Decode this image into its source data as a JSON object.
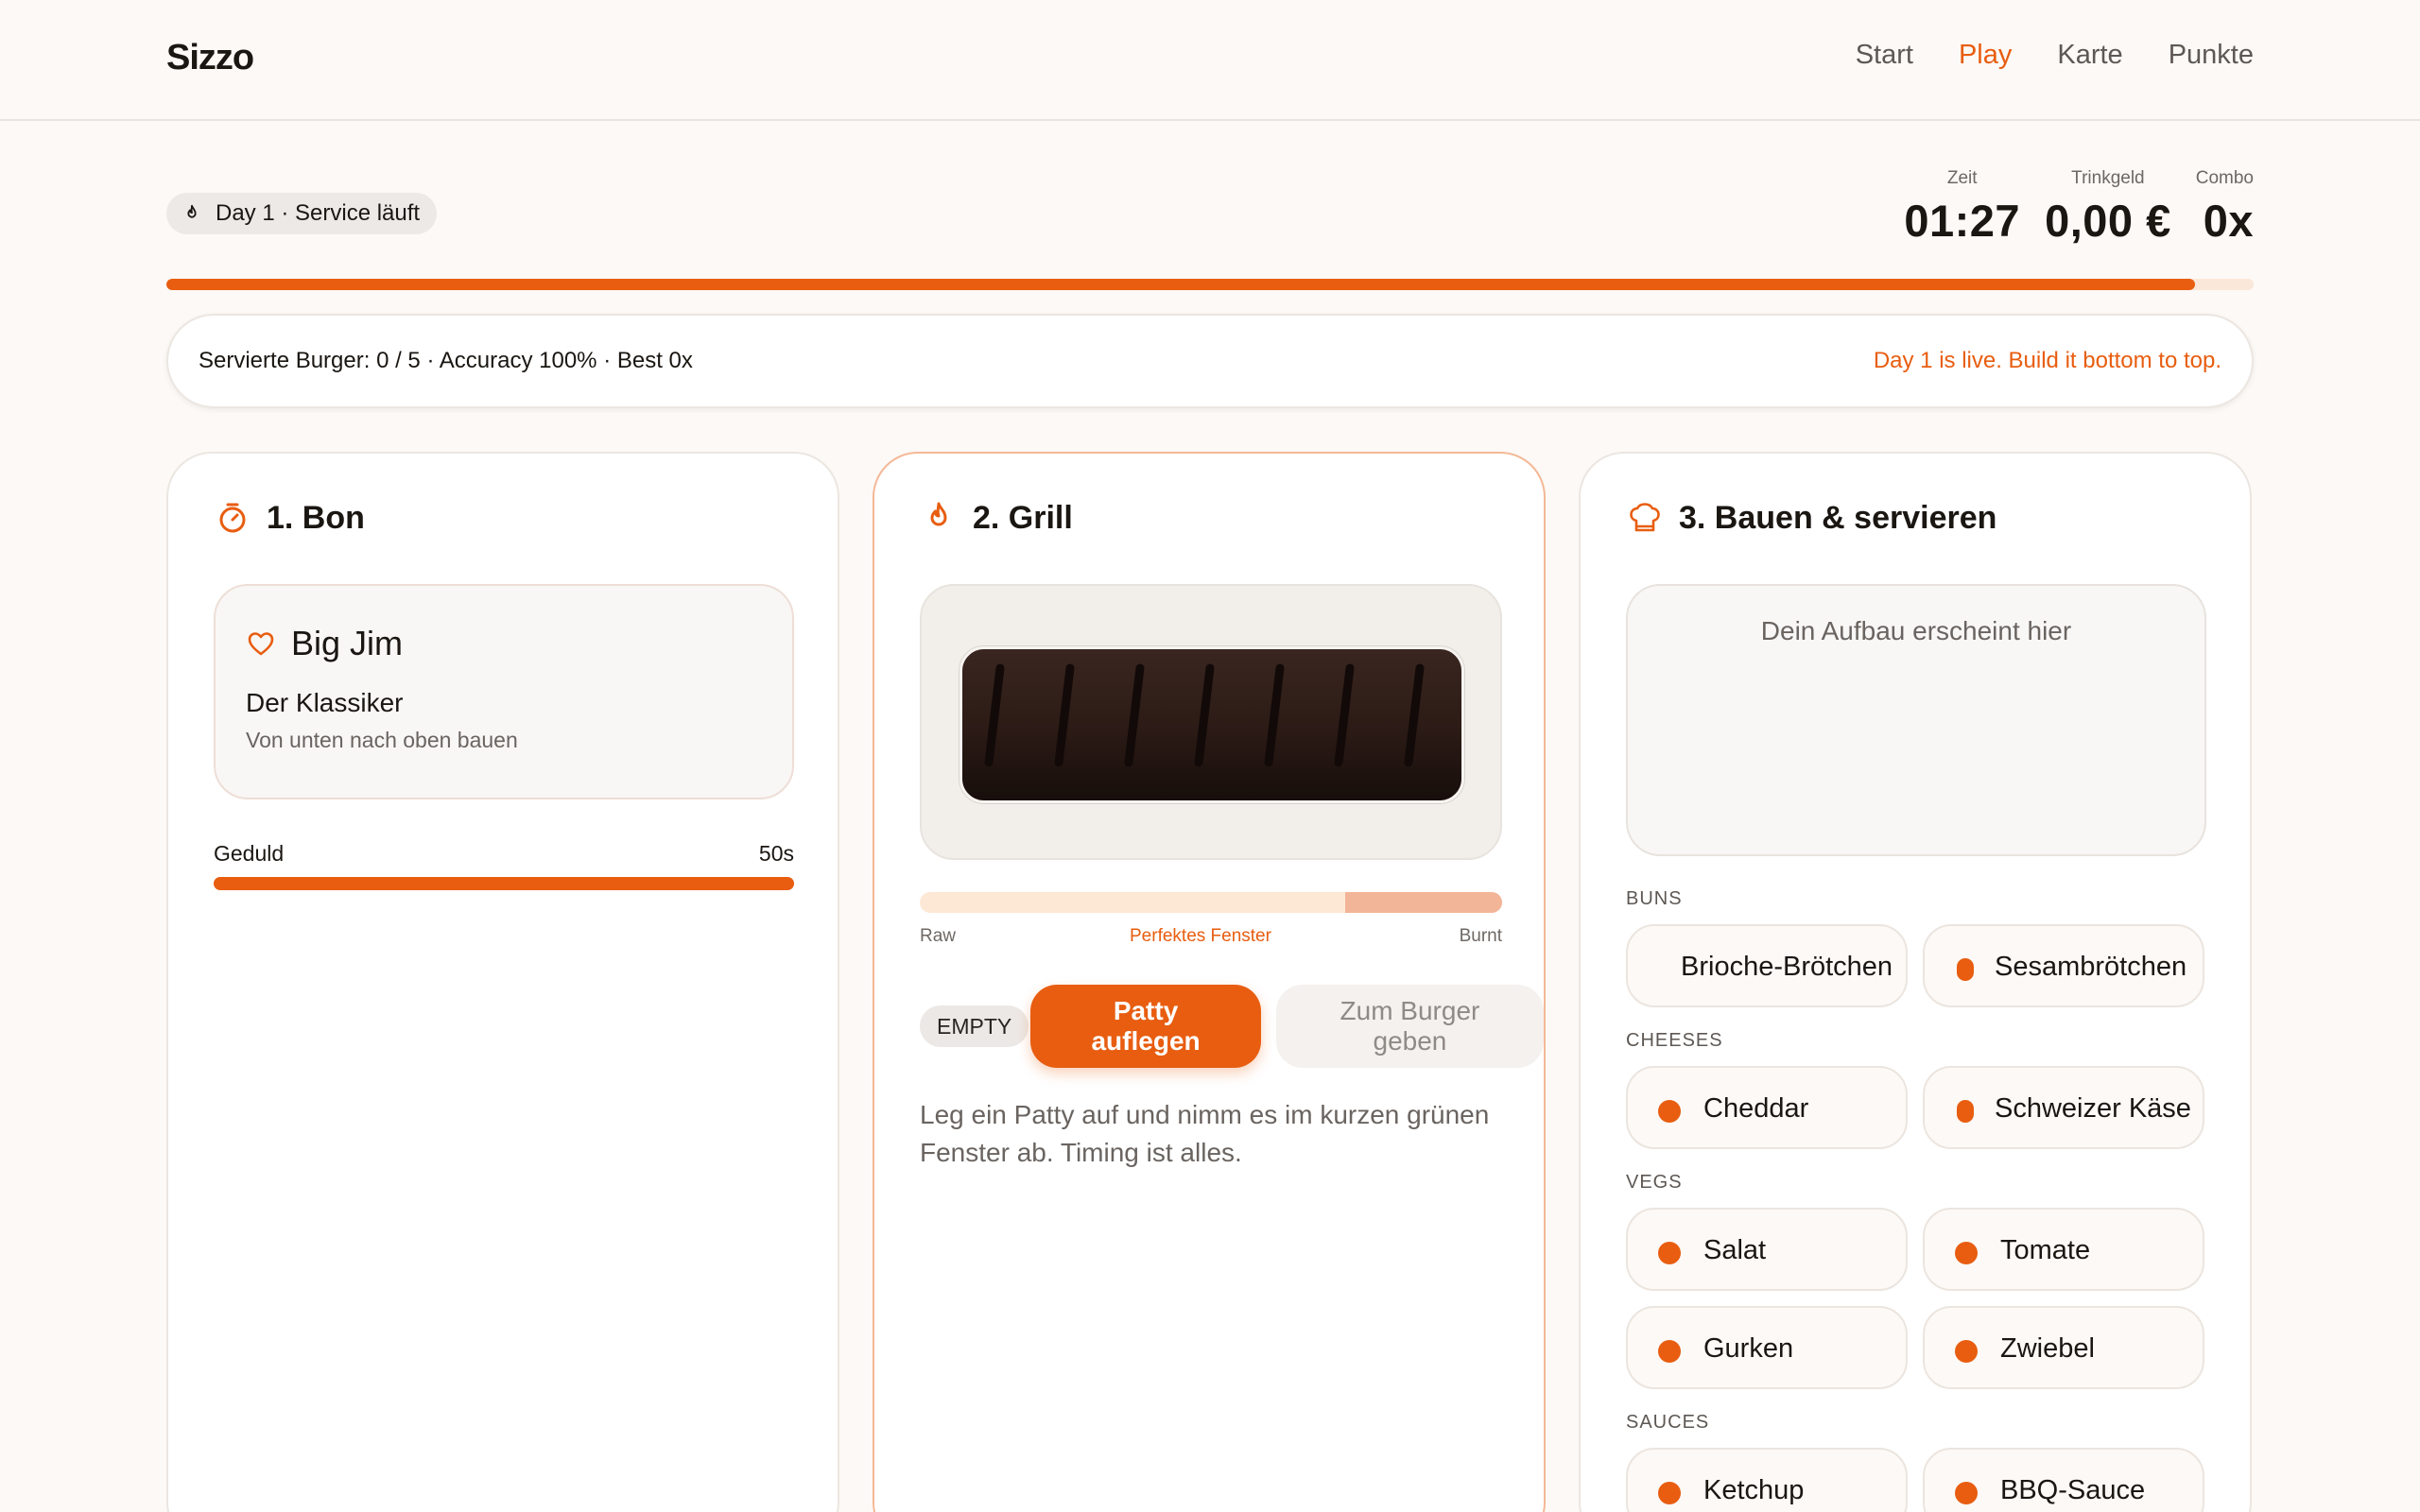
{
  "brand": "Sizzo",
  "nav": [
    {
      "label": "Start",
      "active": false
    },
    {
      "label": "Play",
      "active": true
    },
    {
      "label": "Karte",
      "active": false
    },
    {
      "label": "Punkte",
      "active": false
    }
  ],
  "status": {
    "day_label": "Day 1 · Service läuft",
    "stats": {
      "time": {
        "label": "Zeit",
        "value": "01:27"
      },
      "tips": {
        "label": "Trinkgeld",
        "value": "0,00 €"
      },
      "combo": {
        "label": "Combo",
        "value": "0x"
      }
    },
    "service_progress": 0.972
  },
  "infobar": {
    "summary": "Servierte Burger: 0 / 5 · Accuracy 100% · Best 0x",
    "message": "Day 1 is live. Build it bottom to top."
  },
  "bon": {
    "title": "1. Bon",
    "order_name": "Big Jim",
    "order_sub": "Der Klassiker",
    "order_hint": "Von unten nach oben bauen",
    "patience_label": "Geduld",
    "patience_value": "50s",
    "patience_fraction": 1.0
  },
  "grill": {
    "title": "2. Grill",
    "doneness_scale": {
      "raw": "Raw",
      "perfect": "Perfektes Fenster",
      "burnt": "Burnt"
    },
    "perfect_window": [
      0.73,
      1.0
    ],
    "state": "EMPTY",
    "primary_button": "Patty auflegen",
    "secondary_button": "Zum Burger geben",
    "hint": "Leg ein Patty auf und nimm es im kurzen grünen Fenster ab. Timing ist alles."
  },
  "build": {
    "title": "3. Bauen & servieren",
    "placeholder": "Dein Aufbau erscheint hier",
    "groups": [
      {
        "label": "BUNS",
        "items": [
          "Brioche-Brötchen",
          "Sesambrötchen"
        ]
      },
      {
        "label": "CHEESES",
        "items": [
          "Cheddar",
          "Schweizer Käse"
        ]
      },
      {
        "label": "VEGS",
        "items": [
          "Salat",
          "Tomate",
          "Gurken",
          "Zwiebel"
        ]
      },
      {
        "label": "SAUCES",
        "items": [
          "Ketchup",
          "BBQ-Sauce"
        ]
      }
    ]
  },
  "colors": {
    "accent": "#e85d10",
    "background": "#fcf9f6"
  },
  "icons": {
    "day": "flame-icon",
    "bon": "timer-icon",
    "grill": "flame-icon",
    "build": "chef-hat-icon",
    "order": "heart-icon"
  }
}
